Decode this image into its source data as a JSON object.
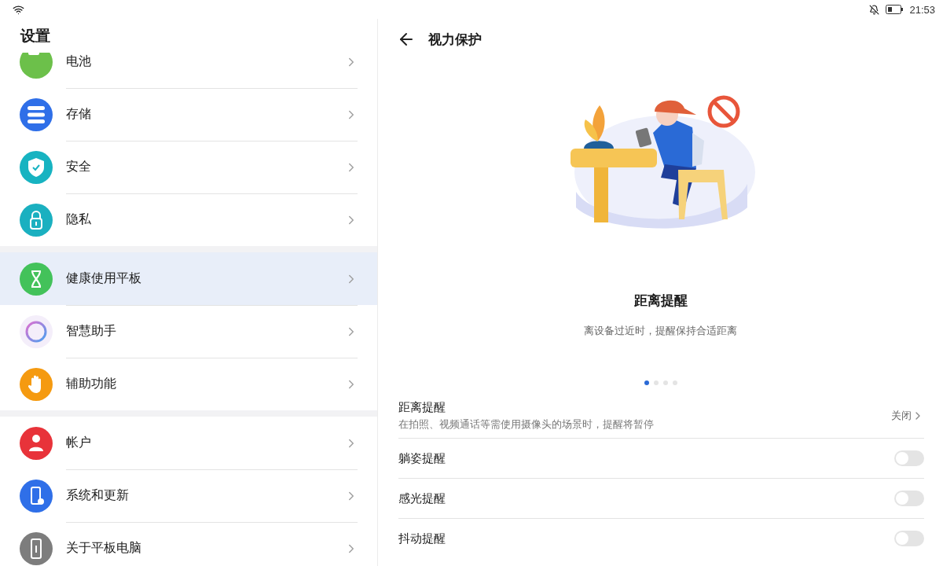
{
  "status_bar": {
    "time": "21:53"
  },
  "sidebar": {
    "title": "设置",
    "groups": [
      [
        {
          "label": "电池",
          "color": "#6cc04a",
          "selected": false
        },
        {
          "label": "存储",
          "color": "#2f6fe8",
          "selected": false
        },
        {
          "label": "安全",
          "color": "#17b3c1",
          "selected": false
        },
        {
          "label": "隐私",
          "color": "#1ab0c0",
          "selected": false
        }
      ],
      [
        {
          "label": "健康使用平板",
          "color": "#43c25a",
          "selected": true
        },
        {
          "label": "智慧助手",
          "color": "#f4eefa",
          "selected": false
        },
        {
          "label": "辅助功能",
          "color": "#f59a10",
          "selected": false
        }
      ],
      [
        {
          "label": "帐户",
          "color": "#e8333a",
          "selected": false
        },
        {
          "label": "系统和更新",
          "color": "#2f6fe8",
          "selected": false
        },
        {
          "label": "关于平板电脑",
          "color": "#7d7d7d",
          "selected": false
        }
      ]
    ]
  },
  "detail": {
    "title": "视力保护",
    "hero": {
      "title": "距离提醒",
      "subtitle": "离设备过近时，提醒保持合适距离"
    },
    "pager": [
      {
        "selected": true
      },
      {
        "selected": false
      },
      {
        "selected": false
      },
      {
        "selected": false
      }
    ],
    "rows": [
      {
        "kind": "link",
        "title": "距离提醒",
        "description": "在拍照、视频通话等需使用摄像头的场景时，提醒将暂停",
        "value": "关闭"
      },
      {
        "kind": "toggle",
        "title": "躺姿提醒",
        "on": false
      },
      {
        "kind": "toggle",
        "title": "感光提醒",
        "on": false
      },
      {
        "kind": "toggle",
        "title": "抖动提醒",
        "on": false
      }
    ]
  }
}
